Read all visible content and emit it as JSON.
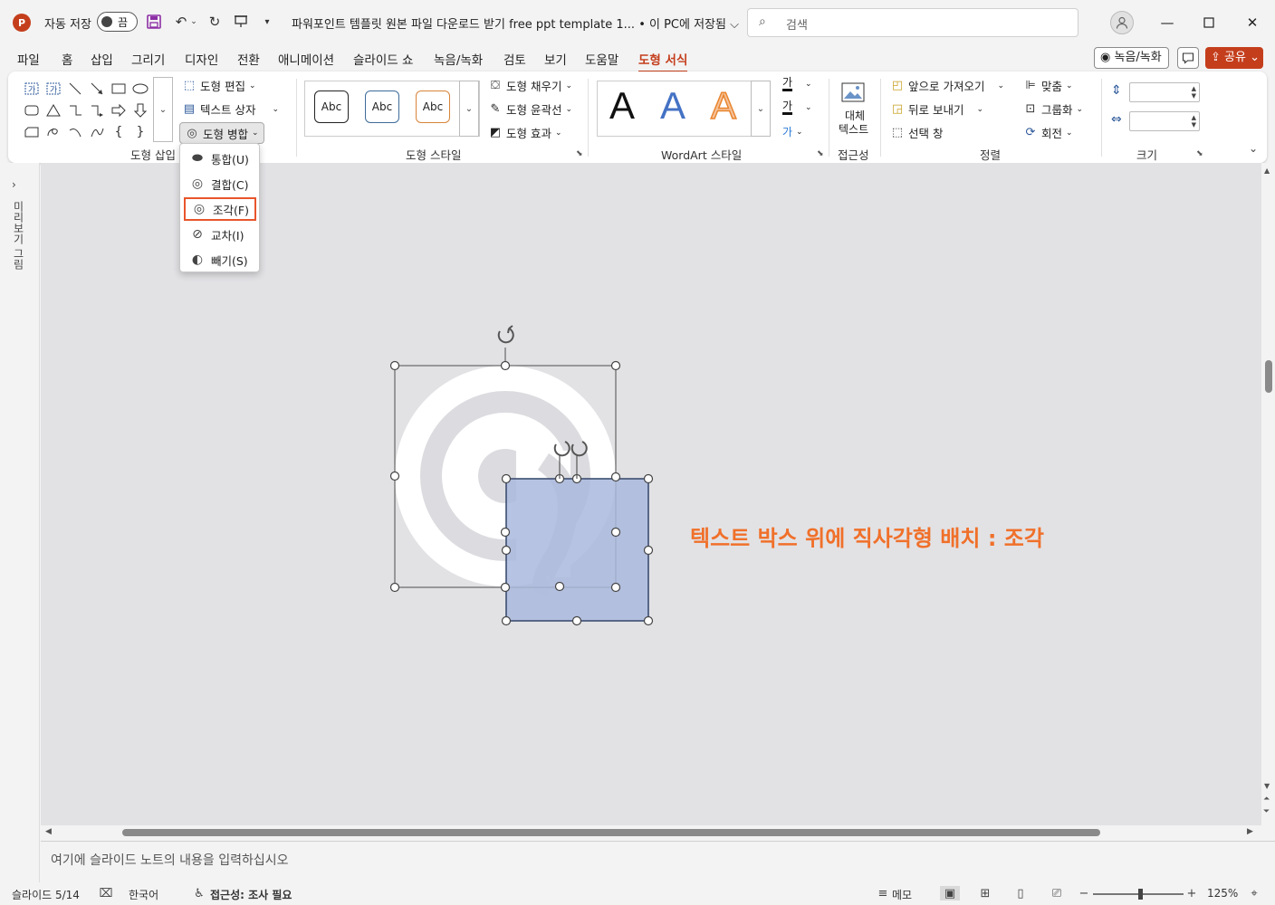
{
  "titlebar": {
    "app_icon": "P",
    "autosave_label": "자동 저장",
    "autosave_state": "끔",
    "doc_title": "파워포인트 템플릿 원본 파일 다운로드 받기 free ppt template 1... • 이 PC에 저장됨 ⌵",
    "search_placeholder": "검색",
    "icons": [
      "powerpoint-icon",
      "save-icon",
      "undo-icon",
      "redo-icon",
      "present-icon",
      "customize-qat-icon",
      "search-icon",
      "user-icon",
      "minimize-icon",
      "maximize-icon",
      "close-icon"
    ]
  },
  "tabs": [
    "파일",
    "홈",
    "삽입",
    "그리기",
    "디자인",
    "전환",
    "애니메이션",
    "슬라이드 쇼",
    "녹음/녹화",
    "검토",
    "보기",
    "도움말",
    "도형 서식"
  ],
  "active_tab": "도형 서식",
  "top_right": {
    "record": "녹음/녹화",
    "share": "공유"
  },
  "ribbon": {
    "insert_shapes": {
      "label": "도형 삽입",
      "edit_shape": "도형 편집",
      "text_box": "텍스트 상자",
      "merge_shapes": "도형 병합"
    },
    "shape_styles": {
      "label": "도형 스타일",
      "preset": "Abc",
      "fill": "도형 채우기",
      "outline": "도형 윤곽선",
      "effects": "도형 효과"
    },
    "wordart": {
      "label": "WordArt 스타일",
      "letter": "A",
      "text_fill": "가",
      "text_outline": "가",
      "text_effect": "가"
    },
    "accessibility": {
      "label": "접근성",
      "alt_text_1": "대체",
      "alt_text_2": "텍스트"
    },
    "arrange": {
      "label": "정렬",
      "bring_forward": "앞으로 가져오기",
      "send_backward": "뒤로 보내기",
      "selection_pane": "선택 창",
      "align": "맞춤",
      "group": "그룹화",
      "rotate": "회전"
    },
    "size": {
      "label": "크기"
    }
  },
  "merge_menu": {
    "items": [
      "통합(U)",
      "결합(C)",
      "조각(F)",
      "교차(I)",
      "빼기(S)"
    ],
    "highlighted": "조각(F)"
  },
  "thumbnail_label": "미리보기 그림",
  "slide": {
    "caption": "텍스트 박스 위에 직사각형 배치 : 조각",
    "caption_color": "#f0702a",
    "rect_color": "#a9b9dd"
  },
  "notes_placeholder": "여기에 슬라이드 노트의 내용을 입력하십시오",
  "statusbar": {
    "slide_info": "슬라이드 5/14",
    "language": "한국어",
    "accessibility": "접근성: 조사 필요",
    "notes": "메모",
    "zoom": "125%"
  },
  "colors": {
    "accent": "#c43e1c",
    "ribbon_bg": "#ffffff",
    "canvas_bg": "#e2e2e5"
  }
}
